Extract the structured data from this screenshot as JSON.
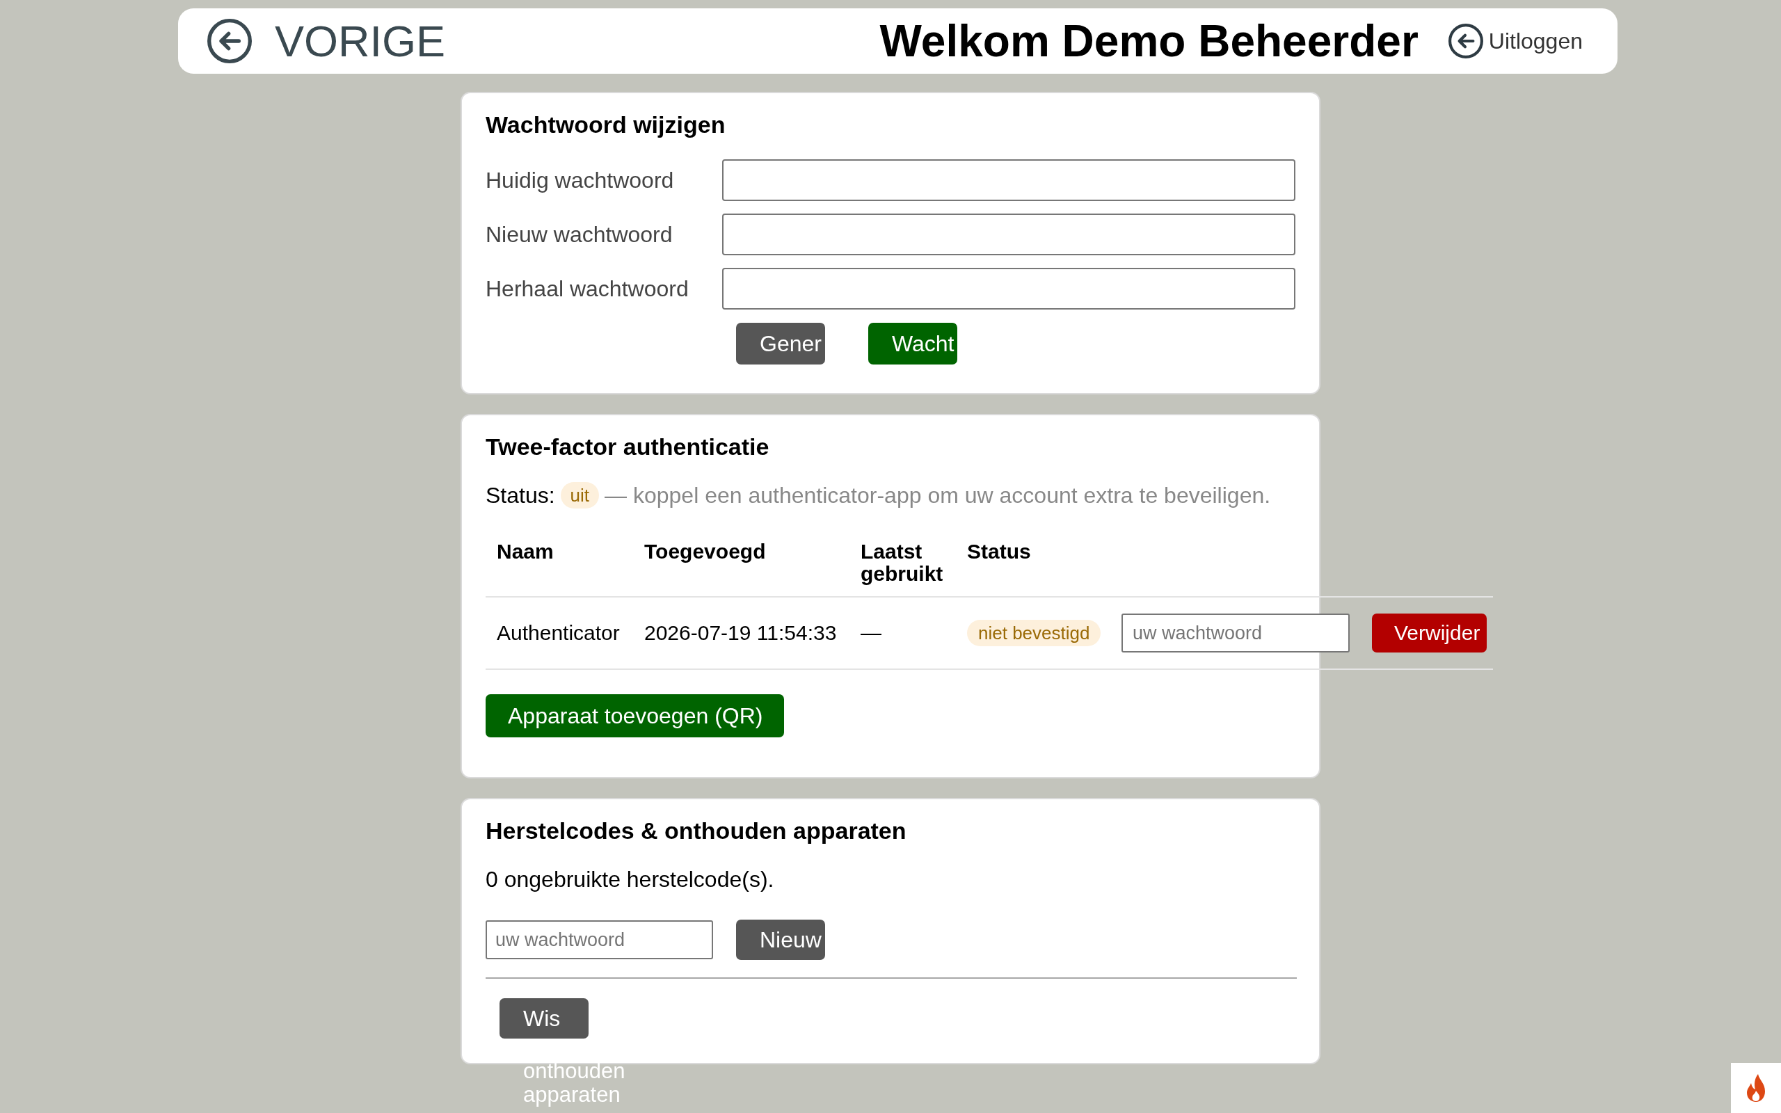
{
  "header": {
    "back_label": "VORIGE",
    "welcome": "Welkom Demo Beheerder",
    "logout_label": "Uitloggen"
  },
  "password_card": {
    "title": "Wachtwoord wijzigen",
    "fields": [
      {
        "label": "Huidig wachtwoord"
      },
      {
        "label": "Nieuw wachtwoord"
      },
      {
        "label": "Herhaal wachtwoord"
      }
    ],
    "buttons": [
      {
        "label": "Gener",
        "kind": "neutral"
      },
      {
        "label": "Wacht",
        "kind": "primary"
      }
    ]
  },
  "two_factor_card": {
    "title": "Twee-factor authenticatie",
    "status_label": "Status:",
    "status_badge": "uit",
    "status_note": "— koppel een authenticator-app om uw account extra te beveiligen.",
    "table": {
      "columns": [
        "Naam",
        "Toegevoegd",
        "Laatst gebruikt",
        "Status"
      ],
      "rows": [
        {
          "name": "Authenticator",
          "added": "2026-07-19 11:54:33",
          "last_used": "—",
          "status": "niet bevestigd",
          "password_placeholder": "uw wachtwoord",
          "delete_button": {
            "label": "Verwijder",
            "kind": "danger"
          }
        }
      ]
    },
    "add_button": {
      "label": "Apparaat toevoegen (QR)",
      "kind": "primary"
    }
  },
  "recovery_card": {
    "title": "Herstelcodes & onthouden apparaten",
    "unused_codes": "0 ongebruikte herstelcode(s).",
    "password_placeholder": "uw wachtwoord",
    "new_codes_button": {
      "label": "Nieuw",
      "kind": "neutral"
    },
    "clear_button": {
      "label": "Wis",
      "kind": "neutral",
      "overflow_text": "onthouden apparaten"
    }
  }
}
